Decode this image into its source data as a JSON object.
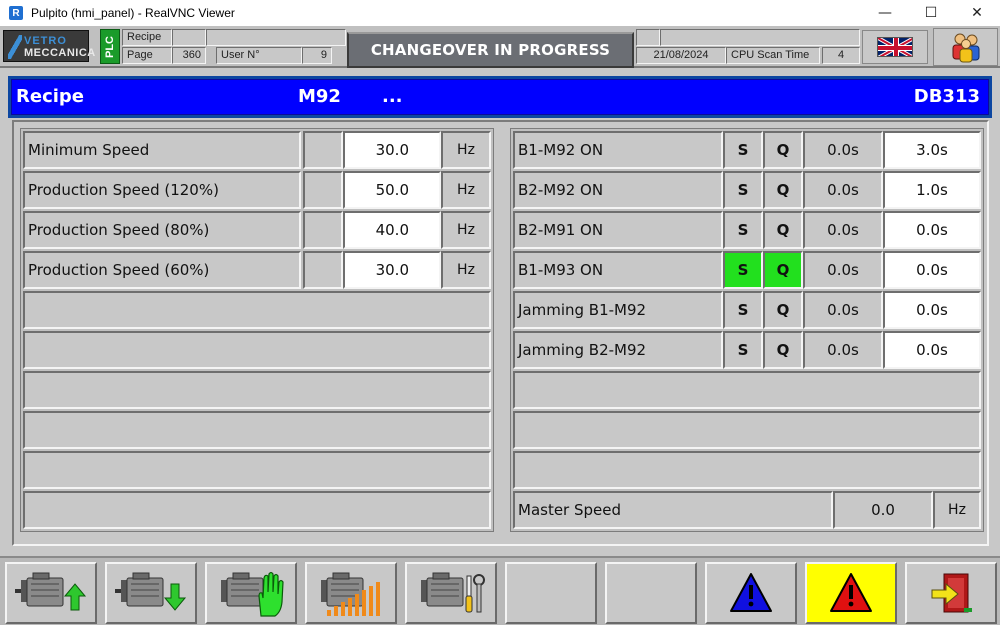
{
  "window": {
    "title": "Pulpito (hmi_panel) - RealVNC Viewer",
    "app_icon_glyph": "R",
    "minimize_glyph": "—",
    "maximize_glyph": "☐",
    "close_glyph": "✕"
  },
  "header": {
    "logo_line1": "VETRO",
    "logo_line2": "MECCANICA",
    "plc_label": "PLC",
    "recipe_label": "Recipe",
    "page_label": "Page",
    "page_value": "360",
    "user_label": "User N°",
    "user_value": "9",
    "status_text": "CHANGEOVER IN PROGRESS",
    "date": "21/08/2024",
    "cpu_label": "CPU Scan Time",
    "cpu_value": "4"
  },
  "recipe_bar": {
    "label": "Recipe",
    "recipe_code": "M92",
    "description": "...",
    "db_name": "DB313"
  },
  "speeds": [
    {
      "label": "Minimum Speed",
      "value": "30.0",
      "unit": "Hz"
    },
    {
      "label": "Production Speed (120%)",
      "value": "50.0",
      "unit": "Hz"
    },
    {
      "label": "Production Speed (80%)",
      "value": "40.0",
      "unit": "Hz"
    },
    {
      "label": "Production Speed (60%)",
      "value": "30.0",
      "unit": "Hz"
    }
  ],
  "timers": [
    {
      "label": "B1-M92 ON",
      "s": "S",
      "q": "Q",
      "active": false,
      "elapsed": "0.0s",
      "preset": "3.0s"
    },
    {
      "label": "B2-M92 ON",
      "s": "S",
      "q": "Q",
      "active": false,
      "elapsed": "0.0s",
      "preset": "1.0s"
    },
    {
      "label": "B2-M91 ON",
      "s": "S",
      "q": "Q",
      "active": false,
      "elapsed": "0.0s",
      "preset": "0.0s"
    },
    {
      "label": "B1-M93 ON",
      "s": "S",
      "q": "Q",
      "active": true,
      "elapsed": "0.0s",
      "preset": "0.0s"
    },
    {
      "label": "Jamming B1-M92",
      "s": "S",
      "q": "Q",
      "active": false,
      "elapsed": "0.0s",
      "preset": "0.0s"
    },
    {
      "label": "Jamming B2-M92",
      "s": "S",
      "q": "Q",
      "active": false,
      "elapsed": "0.0s",
      "preset": "0.0s"
    }
  ],
  "master_speed": {
    "label": "Master Speed",
    "value": "0.0",
    "unit": "Hz"
  },
  "toolbar": {
    "buttons": [
      {
        "name": "motor-up-button",
        "icon": "motor-arrow-up-icon"
      },
      {
        "name": "motor-down-button",
        "icon": "motor-arrow-down-icon"
      },
      {
        "name": "motor-manual-button",
        "icon": "motor-hand-icon"
      },
      {
        "name": "motor-speed-button",
        "icon": "motor-speed-bars-icon"
      },
      {
        "name": "motor-maintenance-button",
        "icon": "motor-tools-icon"
      },
      {
        "name": "empty-button-1",
        "icon": ""
      },
      {
        "name": "empty-button-2",
        "icon": ""
      },
      {
        "name": "warnings-button",
        "icon": "blue-warning-icon"
      },
      {
        "name": "alarms-button",
        "icon": "red-alarm-icon"
      },
      {
        "name": "exit-button",
        "icon": "exit-door-icon"
      }
    ]
  },
  "colors": {
    "recipe_bar_blue": "#0000ff",
    "active_green": "#22e01e",
    "alarm_yellow": "#ffff00",
    "status_banner": "#6b6e74"
  }
}
